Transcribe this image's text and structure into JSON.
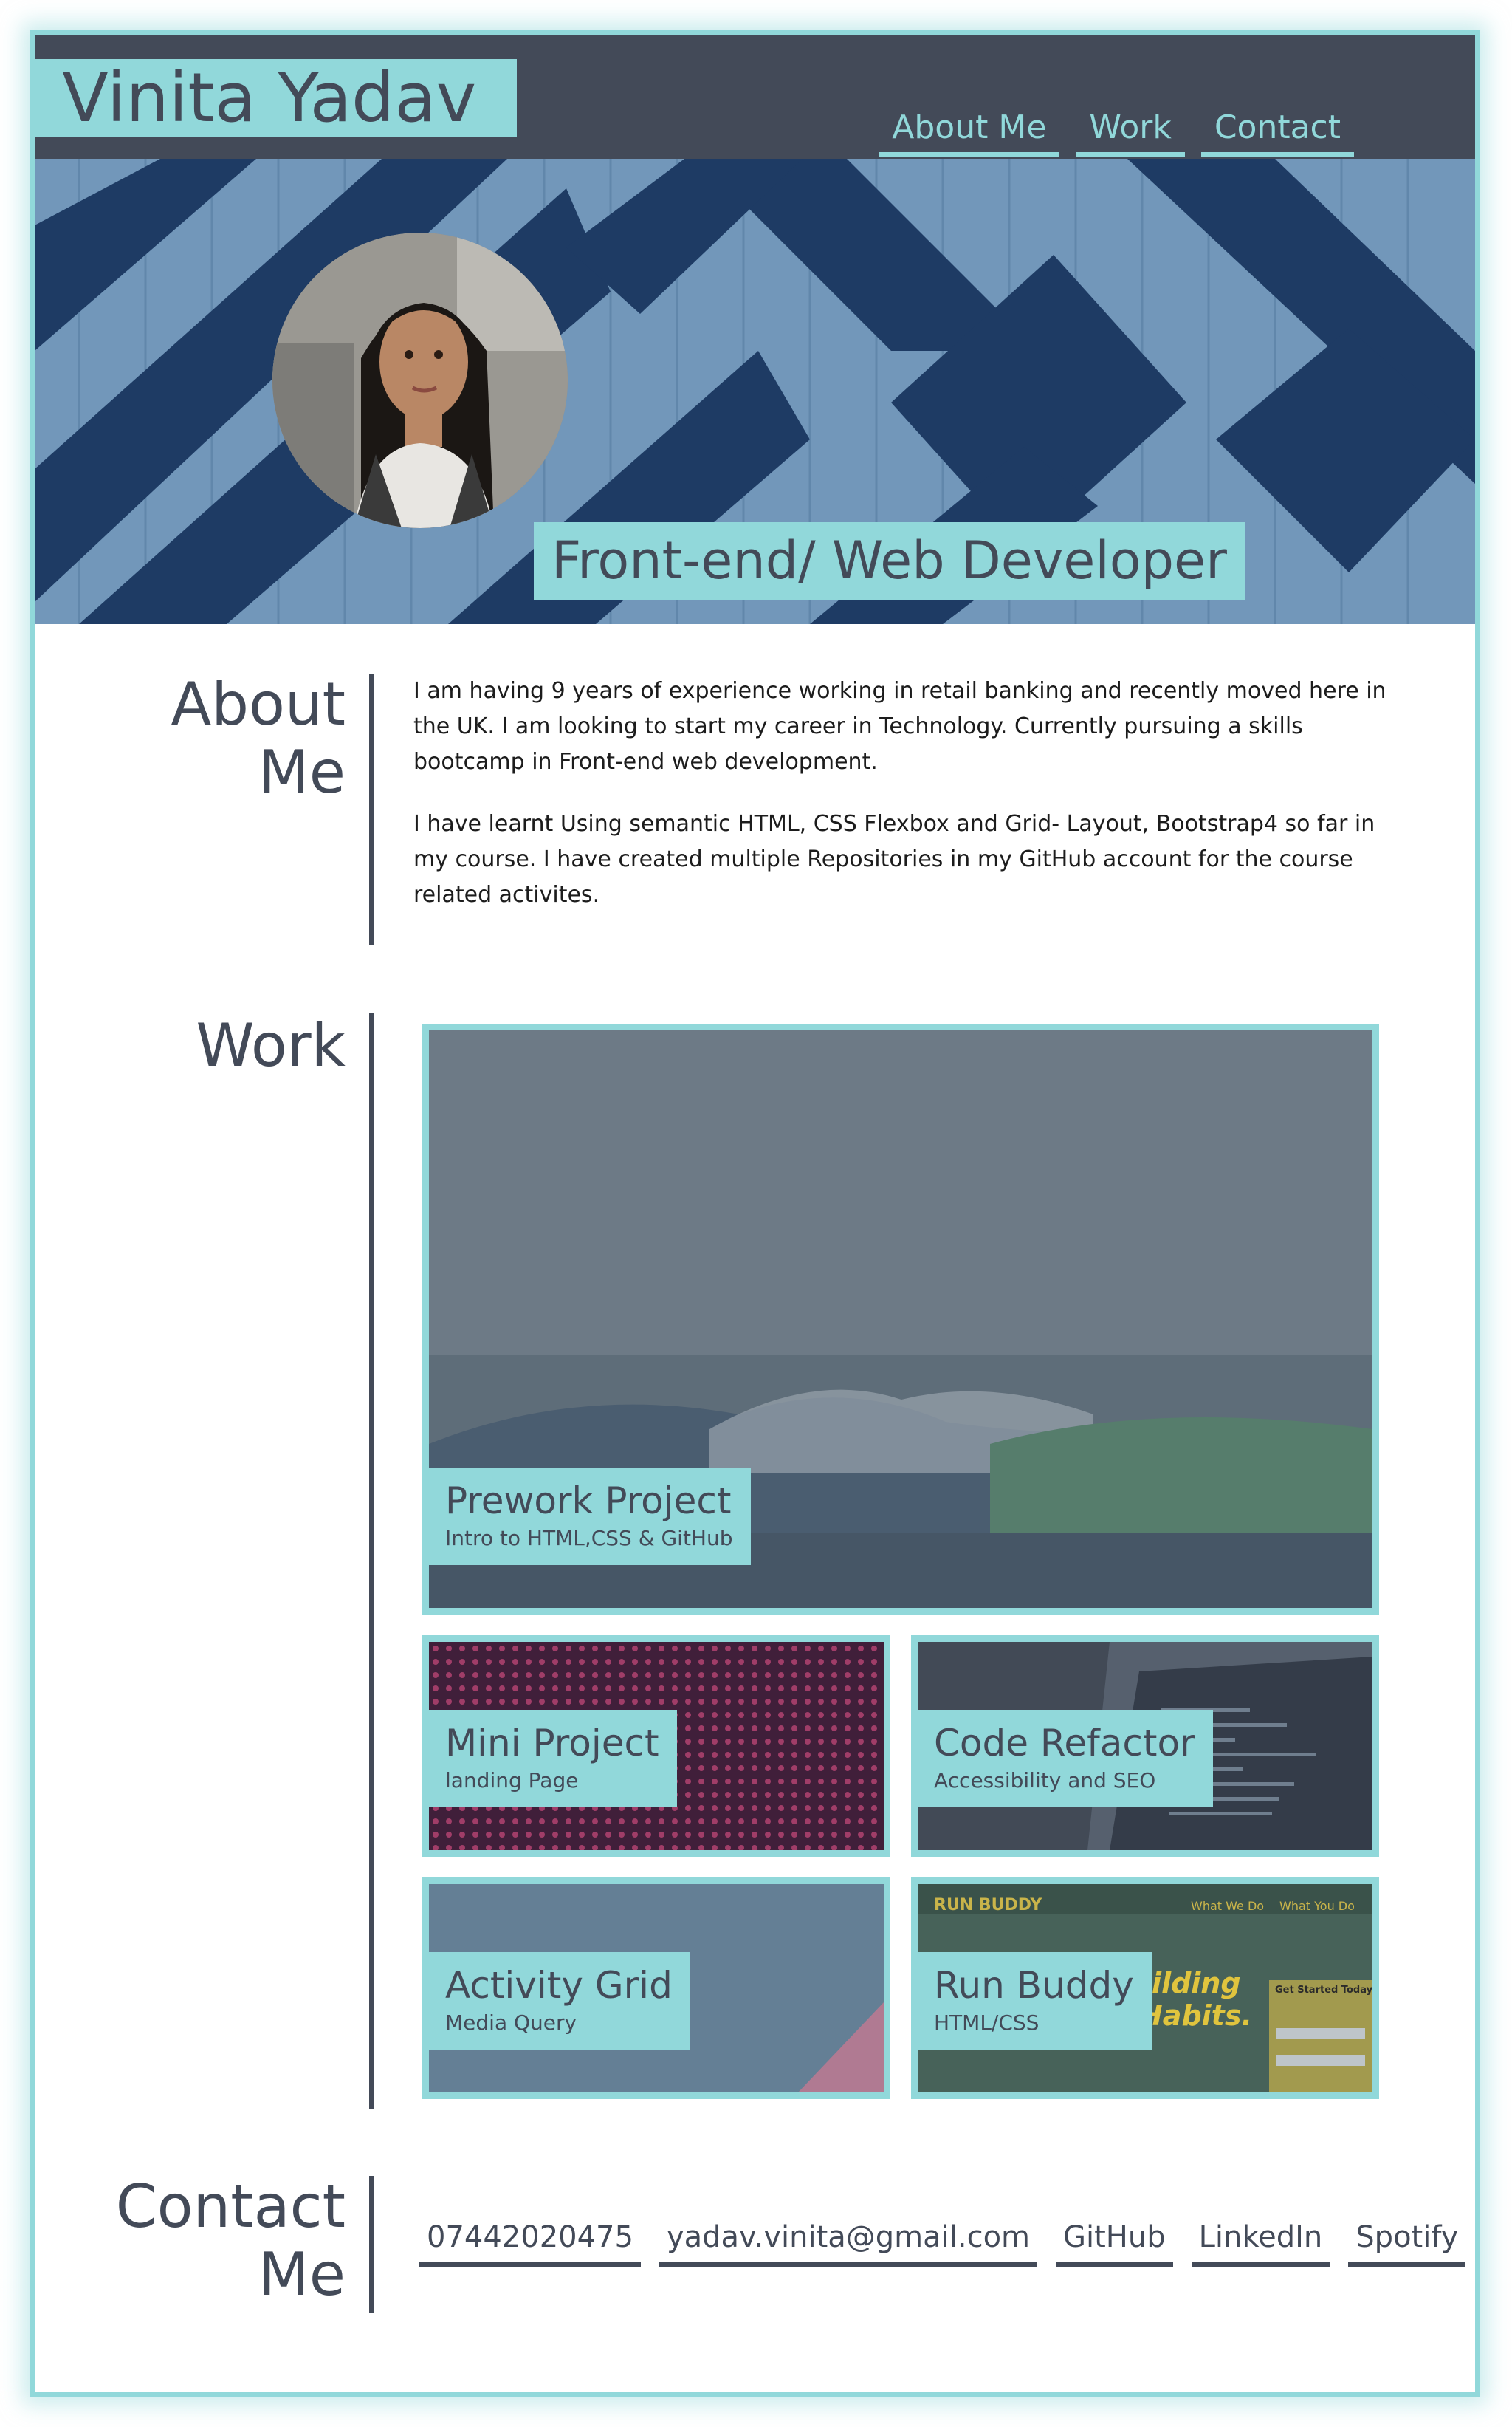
{
  "header": {
    "name": "Vinita Yadav",
    "nav": [
      "About Me",
      "Work",
      "Contact"
    ]
  },
  "hero": {
    "role": "Front-end/ Web Developer"
  },
  "about": {
    "title_line1": "About",
    "title_line2": "Me",
    "paragraphs": [
      "I am having 9 years of experience working in retail banking and recently moved here in the UK. I am looking to start my career in Technology. Currently pursuing a skills bootcamp in Front-end web development.",
      "I have learnt Using semantic HTML, CSS Flexbox and Grid- Layout, Bootstrap4 so far in my course. I have created multiple Repositories in my GitHub account for the course related activites."
    ]
  },
  "work": {
    "title": "Work",
    "projects": [
      {
        "title": "Prework Project",
        "subtitle": "Intro to HTML,CSS & GitHub"
      },
      {
        "title": "Mini Project",
        "subtitle": "landing Page"
      },
      {
        "title": "Code Refactor",
        "subtitle": "Accessibility and SEO"
      },
      {
        "title": "Activity Grid",
        "subtitle": "Media Query"
      },
      {
        "title": "Run Buddy",
        "subtitle": "HTML/CSS"
      }
    ],
    "run_buddy_screenshot": {
      "brand": "RUN BUDDY",
      "nav": [
        "What We Do",
        "What You Do"
      ],
      "headline": [
        "uilding",
        "Habits."
      ],
      "form_title": "Get Started Today"
    }
  },
  "contact": {
    "title_line1": "Contact",
    "title_line2": "Me",
    "links": [
      "07442020475",
      "yadav.vinita@gmail.com",
      "GitHub",
      "LinkedIn",
      "Spotify"
    ]
  },
  "colors": {
    "accent": "#91d8da",
    "dark": "#434a58",
    "hero_blue": "#1e3a63"
  }
}
